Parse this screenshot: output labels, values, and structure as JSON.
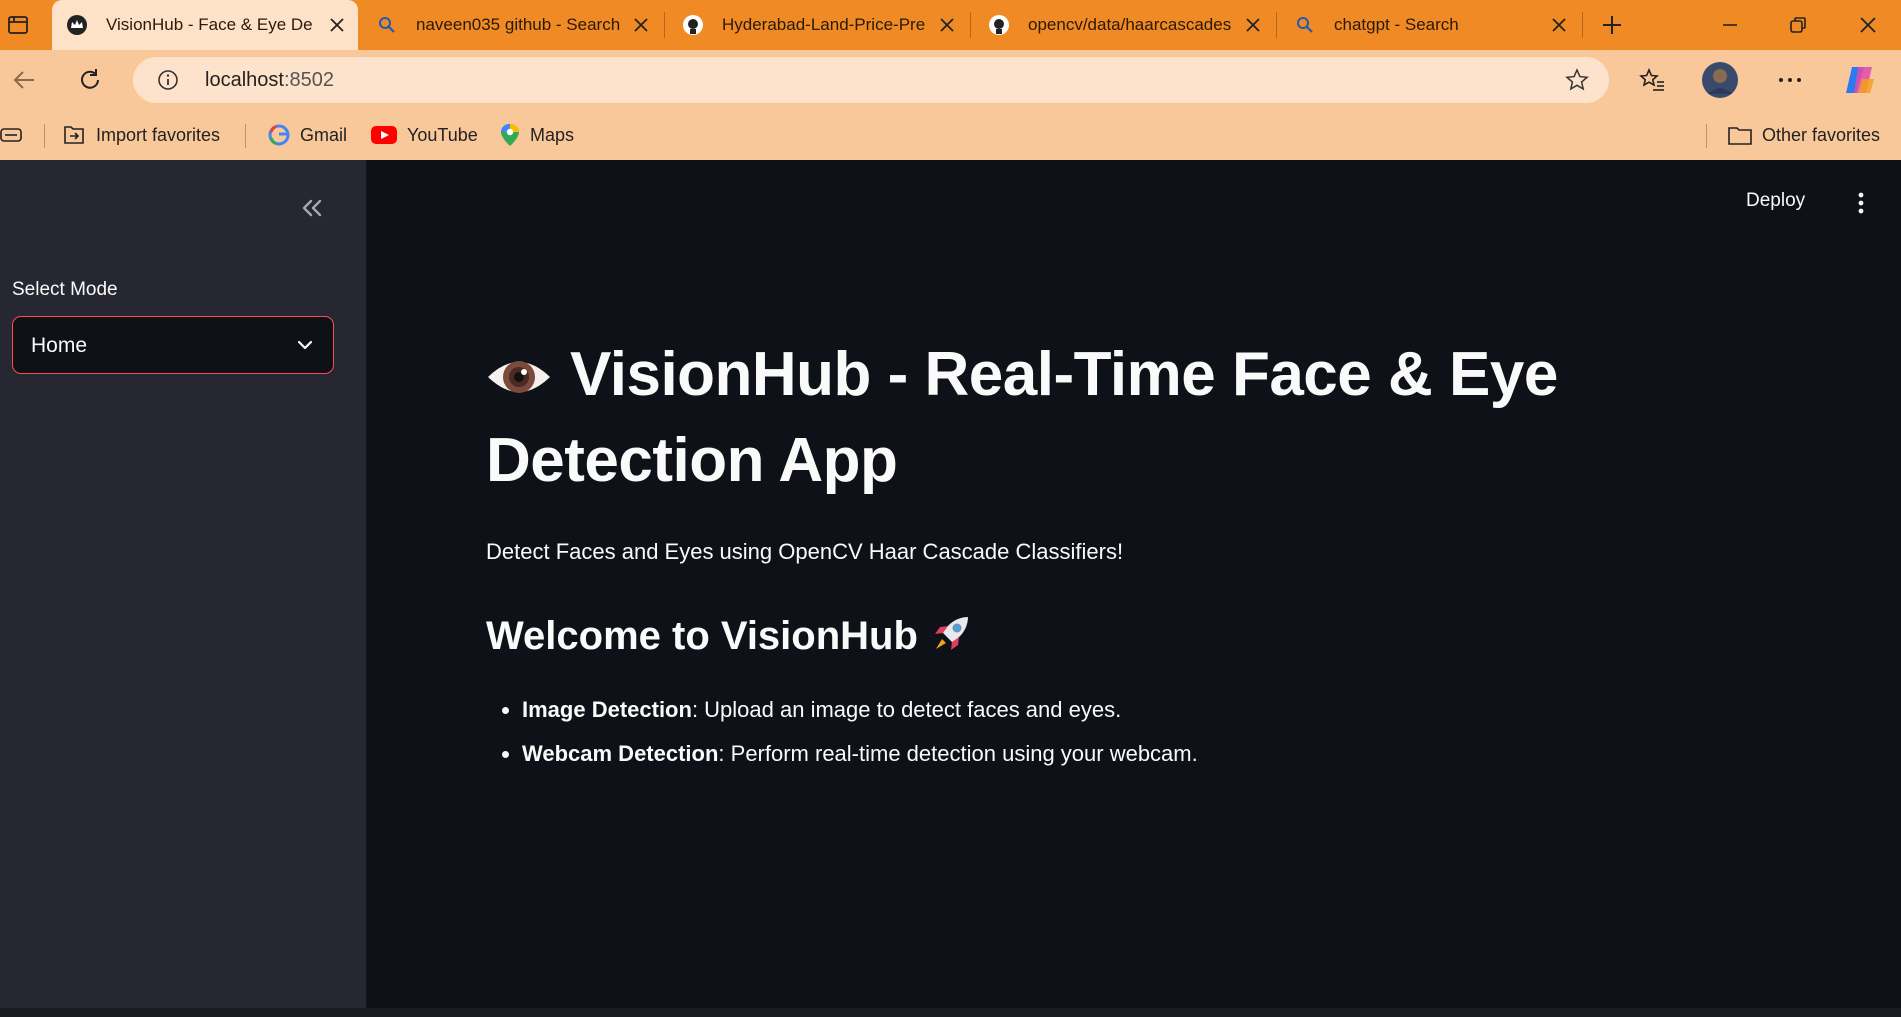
{
  "browser": {
    "tabs": [
      {
        "title": "VisionHub - Face & Eye De",
        "icon": "streamlit-crown-icon",
        "active": true
      },
      {
        "title": "naveen035 github - Search",
        "icon": "search-icon",
        "active": false
      },
      {
        "title": "Hyderabad-Land-Price-Pre",
        "icon": "github-icon",
        "active": false
      },
      {
        "title": "opencv/data/haarcascades",
        "icon": "github-icon",
        "active": false
      },
      {
        "title": "chatgpt - Search",
        "icon": "search-icon",
        "active": false
      }
    ],
    "address": {
      "host": "localhost",
      "port": ":8502"
    },
    "bookmarks": [
      {
        "label": "Import favorites",
        "icon": "import-icon"
      },
      {
        "label": "Gmail",
        "icon": "google-icon"
      },
      {
        "label": "YouTube",
        "icon": "youtube-icon"
      },
      {
        "label": "Maps",
        "icon": "maps-pin-icon"
      }
    ],
    "other_favorites": "Other favorites",
    "colors": {
      "tabstrip": "#f08a24",
      "toolbar": "#f9c89a"
    }
  },
  "sidebar": {
    "select_label": "Select Mode",
    "select_value": "Home",
    "accent": "#ff4b4b"
  },
  "header": {
    "deploy_label": "Deploy"
  },
  "main": {
    "title_line1": "VisionHub - Real-Time Face & Eye",
    "title_line2": "Detection App",
    "subtitle": "Detect Faces and Eyes using OpenCV Haar Cascade Classifiers!",
    "welcome": "Welcome to VisionHub",
    "features": [
      {
        "bold": "Image Detection",
        "text": ": Upload an image to detect faces and eyes."
      },
      {
        "bold": "Webcam Detection",
        "text": ": Perform real-time detection using your webcam."
      }
    ]
  }
}
